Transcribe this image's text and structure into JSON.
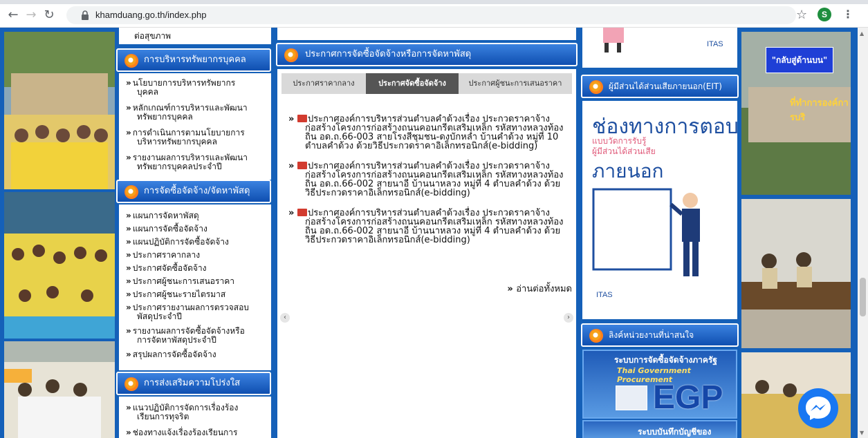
{
  "browser": {
    "url": "khamduang.go.th/index.php",
    "profile_initial": "S"
  },
  "menu": {
    "top_fragment": "ต่อสุขภาพ",
    "sections": [
      {
        "title": "การบริหารทรัพยากรบุคคล",
        "items": [
          [
            "นโยบายการบริหารทรัพยากร",
            "บุคคล"
          ],
          [
            "หลักเกณฑ์การบริหารและพัฒนา",
            "ทรัพยากรบุคคล"
          ],
          [
            "การดำเนินการตามนโยบายการ",
            "บริหารทรัพยากรบุคคล"
          ],
          [
            "รายงานผลการบริหารและพัฒนา",
            "ทรัพยากรบุคคลประจำปี"
          ]
        ]
      },
      {
        "title": "การจัดซื้อจัดจ้าง/จัดหาพัสดุ",
        "items": [
          [
            "แผนการจัดหาพัสดุ"
          ],
          [
            "แผนการจัดซื้อจัดจ้าง"
          ],
          [
            "แผนปฏิบัติการจัดซื้อจัดจ้าง"
          ],
          [
            "ประกาศราคากลาง"
          ],
          [
            "ประกาศจัดซื้อจัดจ้าง"
          ],
          [
            "ประกาศผู้ชนะการเสนอราคา"
          ],
          [
            "ประกาศผู้ชนะรายไตรมาส"
          ],
          [
            "ประกาศรายงานผลการตรวจสอบ",
            "พัสดุประจำปี"
          ],
          [
            "รายงานผลการจัดซื้อจัดจ้างหรือ",
            "การจัดหาพัสดุประจำปี"
          ],
          [
            "สรุปผลการจัดซื้อจัดจ้าง"
          ]
        ]
      },
      {
        "title": "การส่งเสริมความโปร่งใส",
        "items": [
          [
            "แนวปฏิบัติการจัดการเรื่องร้อง",
            "เรียนการทุจริต"
          ],
          [
            "ช่องทางแจ้งเรื่องร้องเรียนการ"
          ]
        ]
      }
    ]
  },
  "procurement": {
    "title": "ประกาศการจัดซื้อจัดจ้างหรือการจัดหาพัสดุ",
    "tabs": [
      "ประกาศราคากลาง",
      "ประกาศจัดซื้อจัดจ้าง",
      "ประกาศผู้ชนะการเสนอราคา"
    ],
    "active_tab": 1,
    "news": [
      [
        "ประกาศองค์การบริหารส่วนตำบลคำด้วงเรื่อง ประกวดราคาจ้าง",
        "ก่อสร้างโครงการก่อสร้างถนนคอนกรีตเสริมเหล็ก รหัสทางหลวงท้อง",
        "ถิ่น อด.ถ.66-003 สายโรงสีชุมชน-ดงบักหล่ำ บ้านคำด้วง หมู่ที่ 10",
        "ตำบลคำด้วง ด้วยวิธีประกวดราคาอิเล็กทรอนิกส์(e-bidding)"
      ],
      [
        "ประกาศองค์การบริหารส่วนตำบลคำด้วงเรื่อง ประกวดราคาจ้าง",
        "ก่อสร้างโครงการก่อสร้างถนนคอนกรีตเสริมเหล็ก รหัสทางหลวงท้อง",
        "ถิ่น อด.ถ.66-002 สายนาอี บ้านนาหลวง หมู่ที่ 4 ตำบลคำด้วง ด้วย",
        "วิธีประกวดราคาอิเล็กทรอนิกส์(e-bidding)"
      ],
      [
        "ประกาศองค์การบริหารส่วนตำบลคำด้วงเรื่อง ประกวดราคาจ้าง",
        "ก่อสร้างโครงการก่อสร้างถนนคอนกรีตเสริมเหล็ก รหัสทางหลวงท้อง",
        "ถิ่น อด.ถ.66-002 สายนาอี บ้านนาหลวง หมู่ที่ 4 ตำบลคำด้วง ด้วย",
        "วิธีประกวดราคาอิเล็กทรอนิกส์(e-bidding)"
      ]
    ],
    "read_all": "อ่านต่อทั้งหมด"
  },
  "right": {
    "eit_header": "ผู้มีส่วนได้ส่วนเสียภายนอก(EIT)",
    "eit_title": "ช่องทางการตอบ",
    "eit_sub1": "แบบวัดการรับรู้",
    "eit_sub2": "ผู้มีส่วนได้ส่วนเสีย",
    "eit_sub3": "ภายนอก",
    "itas": "ITAS",
    "links_header": "ลิงค์หน่วยงานที่น่าสนใจ",
    "egp_line1": "ระบบการจัดซื้อจัดจ้างภาครัฐ",
    "egp_line2": "Thai Government Procurement",
    "egp_logo": "EGP",
    "egp2_line": "ระบบบันทึกบัญชีของ"
  },
  "back_to_top": "\"กลับสู่ด้านบน\"",
  "side_photo_text": "ที่ทำการองค์การบริ"
}
